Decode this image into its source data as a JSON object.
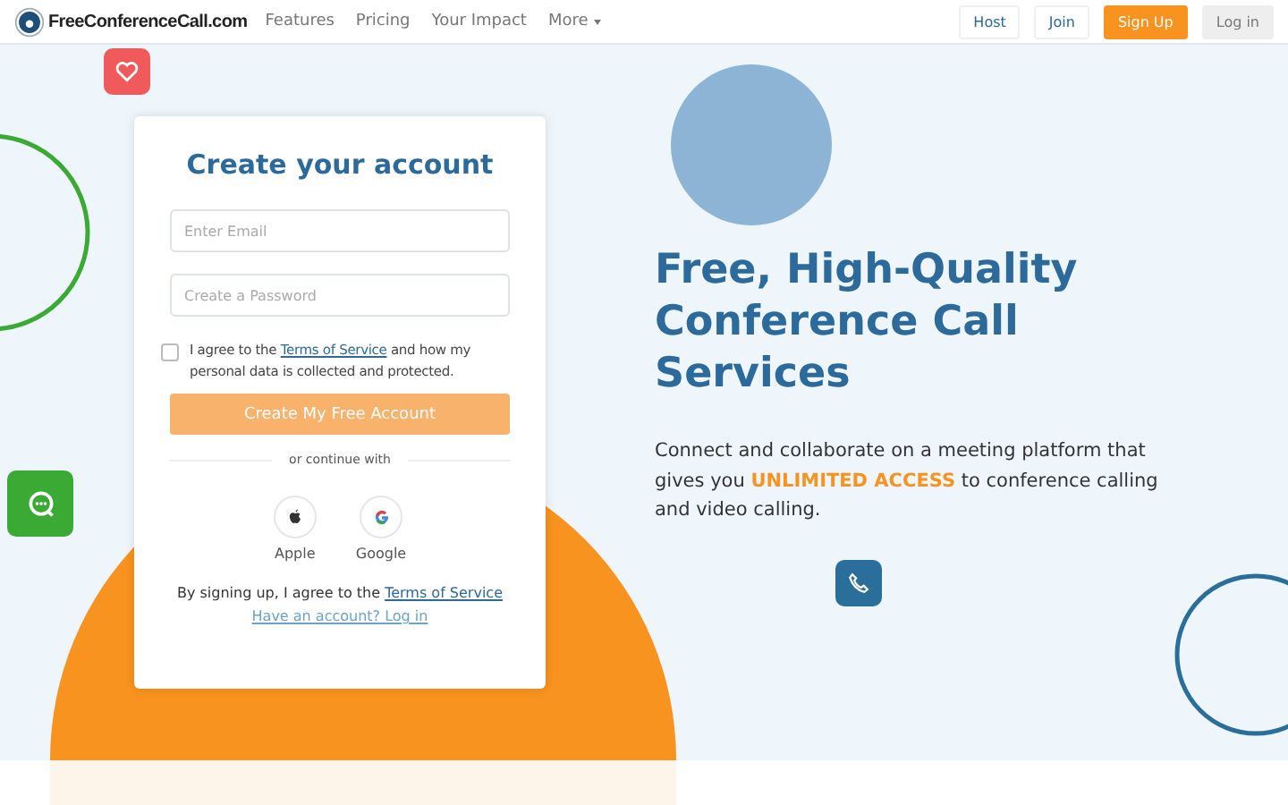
{
  "header": {
    "logo": "FreeConferenceCall.com",
    "nav": [
      {
        "label": "Features",
        "kind": "link"
      },
      {
        "label": "Pricing",
        "kind": "link"
      },
      {
        "label": "Your Impact",
        "kind": "link"
      },
      {
        "label": "More",
        "kind": "dropdown"
      }
    ],
    "actions": [
      {
        "label": "Host",
        "kind": "plain"
      },
      {
        "label": "Join",
        "kind": "plain"
      },
      {
        "label": "Sign Up",
        "kind": "primary"
      },
      {
        "label": "Log in",
        "kind": "muted"
      }
    ]
  },
  "form": {
    "title": "Create your account",
    "email": {
      "placeholder": "Enter Email"
    },
    "password": {
      "placeholder": "Create a Password"
    },
    "agree": {
      "checked": false,
      "before": "I agree to the",
      "link": "Terms of Service",
      "after": "and how my personal data is collected and protected."
    },
    "submit": "Create My Free Account",
    "divider": "or continue with",
    "providers": [
      {
        "label": "Apple",
        "kind": "apple"
      },
      {
        "label": "Google",
        "kind": "google"
      }
    ],
    "terms": {
      "before": "By signing up, I agree to the",
      "link": "Terms of Service"
    },
    "login_link": "Have an account? Log in"
  },
  "hero": {
    "headline": "Free, High-Quality Conference Call Services",
    "text": "Connect and collaborate on a meeting platform that gives you **UNLIMITED ACCESS** to conference calling and video calling."
  }
}
